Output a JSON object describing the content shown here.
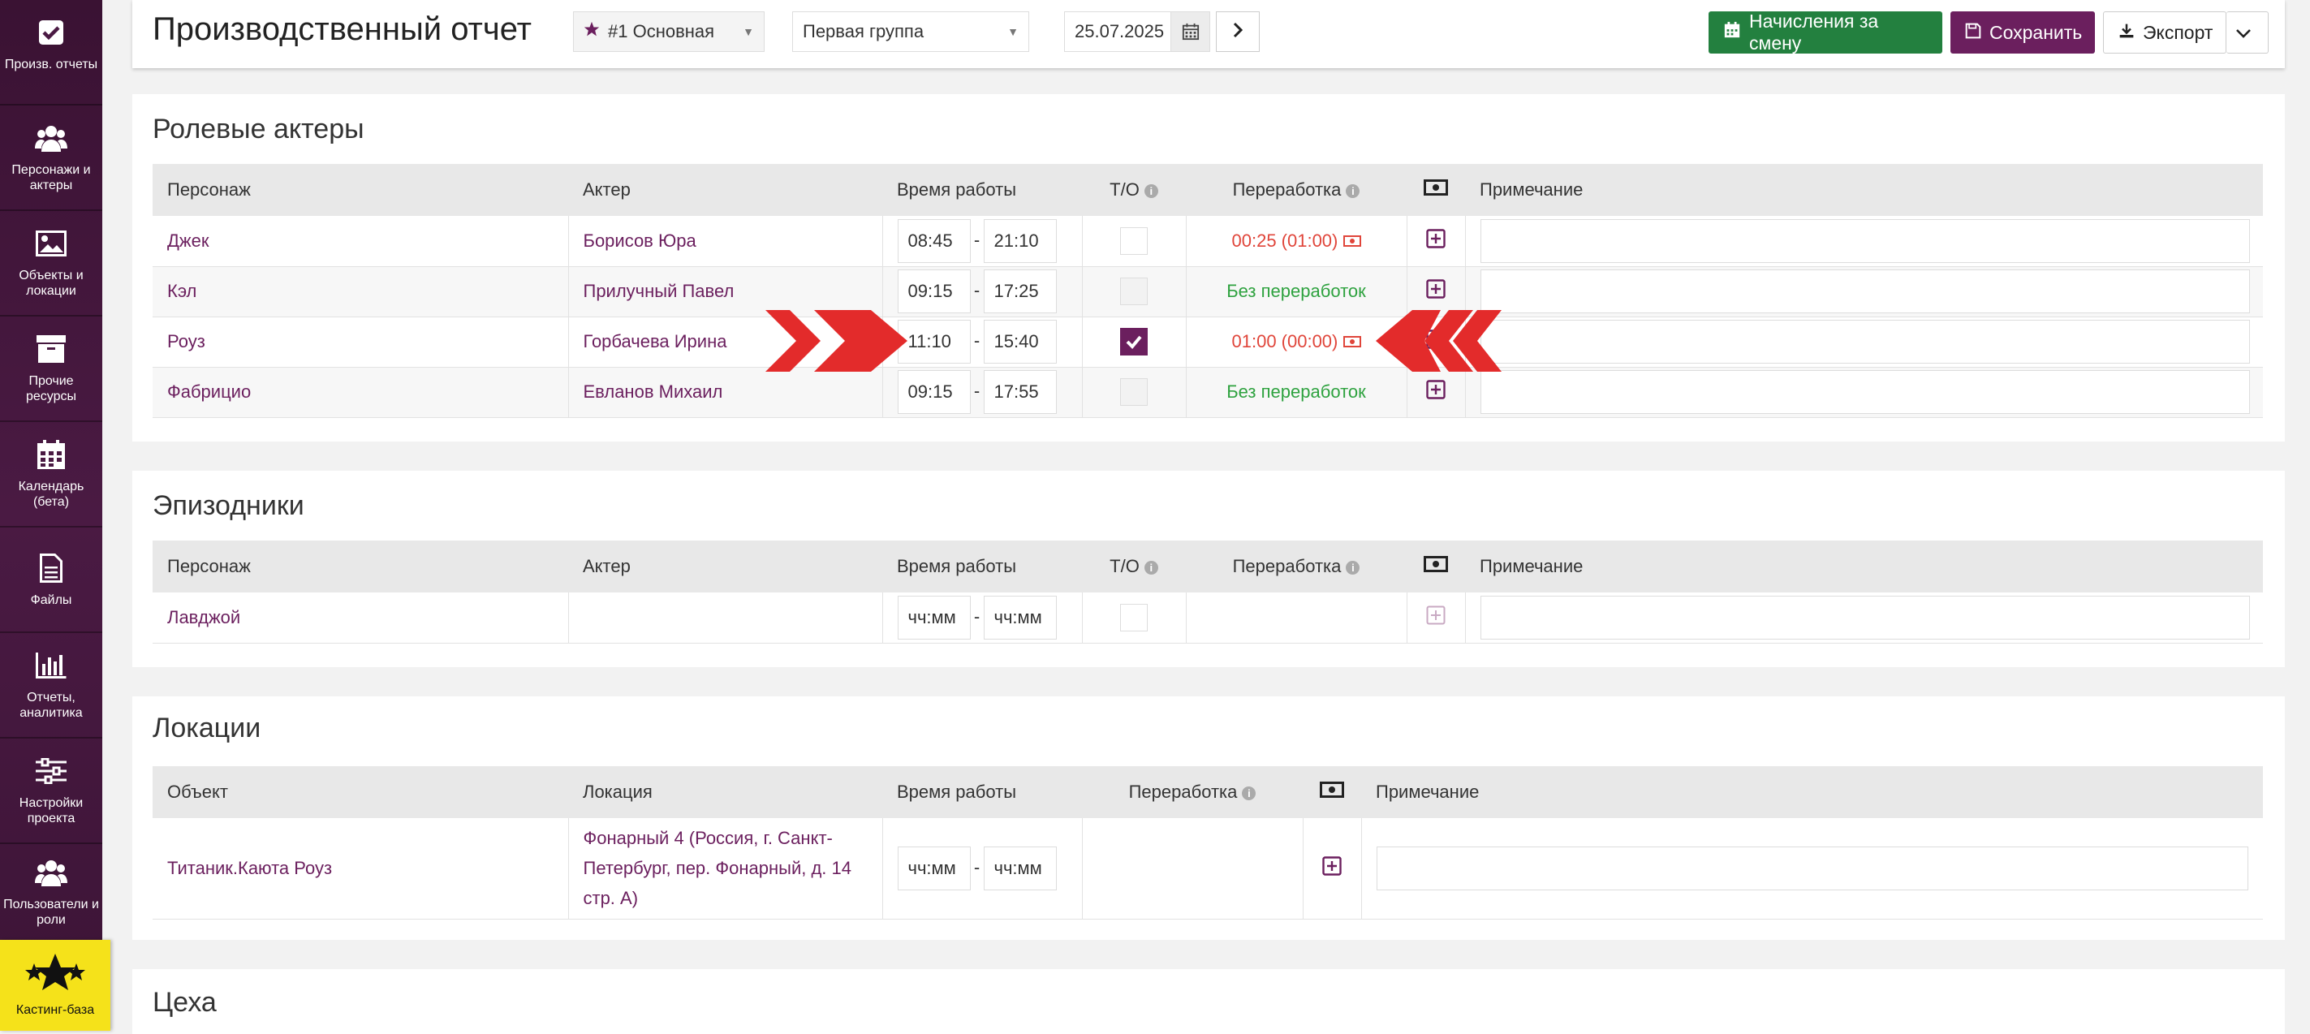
{
  "sidebar": {
    "items": [
      {
        "label": "Произв. отчеты",
        "icon": "check-square-icon"
      },
      {
        "label": "Персонажи и актеры",
        "icon": "users-icon"
      },
      {
        "label": "Объекты и локации",
        "icon": "image-icon"
      },
      {
        "label": "Прочие ресурсы",
        "icon": "archive-icon"
      },
      {
        "label": "Календарь (бета)",
        "icon": "calendar-icon"
      },
      {
        "label": "Файлы",
        "icon": "file-icon"
      },
      {
        "label": "Отчеты, аналитика",
        "icon": "bar-chart-icon"
      },
      {
        "label": "Настройки проекта",
        "icon": "sliders-icon"
      },
      {
        "label": "Пользователи и роли",
        "icon": "users-icon"
      }
    ],
    "casting": {
      "label": "Кастинг-база",
      "icon": "stars-icon"
    }
  },
  "header": {
    "title": "Производственный отчет",
    "report_select": "#1 Основная",
    "group_select": "Первая группа",
    "date": "25.07.2025",
    "btn_shift": "Начисления за смену",
    "btn_save": "Сохранить",
    "btn_export": "Экспорт"
  },
  "colors": {
    "brand": "#6b1f5e",
    "green": "#23803f",
    "red_arrow": "#e32b2b",
    "casting": "#f5e21a"
  },
  "roles": {
    "title": "Ролевые актеры",
    "columns": [
      "Персонаж",
      "Актер",
      "Время работы",
      "Т/О",
      "Переработка",
      "Примечание"
    ],
    "rows": [
      {
        "character": "Джек",
        "actor": "Борисов Юра",
        "start": "08:45",
        "end": "21:10",
        "to": false,
        "overtime": "00:25 (01:00)"
      },
      {
        "character": "Кэл",
        "actor": "Прилучный Павел",
        "start": "09:15",
        "end": "17:25",
        "to": false,
        "overtime": "Без переработок"
      },
      {
        "character": "Роуз",
        "actor": "Горбачева Ирина",
        "start": "11:10",
        "end": "15:40",
        "to": true,
        "overtime": "01:00 (00:00)"
      },
      {
        "character": "Фабрицио",
        "actor": "Евланов Михаил",
        "start": "09:15",
        "end": "17:55",
        "to": false,
        "overtime": "Без переработок"
      }
    ]
  },
  "episodic": {
    "title": "Эпизодники",
    "columns": [
      "Персонаж",
      "Актер",
      "Время работы",
      "Т/О",
      "Переработка",
      "Примечание"
    ],
    "rows": [
      {
        "character": "Лавджой",
        "actor": "",
        "start_placeholder": "чч:мм",
        "end_placeholder": "чч:мм"
      }
    ]
  },
  "locations": {
    "title": "Локации",
    "columns": [
      "Объект",
      "Локация",
      "Время работы",
      "Переработка",
      "Примечание"
    ],
    "rows": [
      {
        "object": "Титаник.Каюта Роуз",
        "location": "Фонарный 4 (Россия, г. Санкт-Петербург, пер. Фонарный, д. 14 стр. А)",
        "start_placeholder": "чч:мм",
        "end_placeholder": "чч:мм"
      }
    ]
  },
  "workshops": {
    "title": "Цеха"
  }
}
